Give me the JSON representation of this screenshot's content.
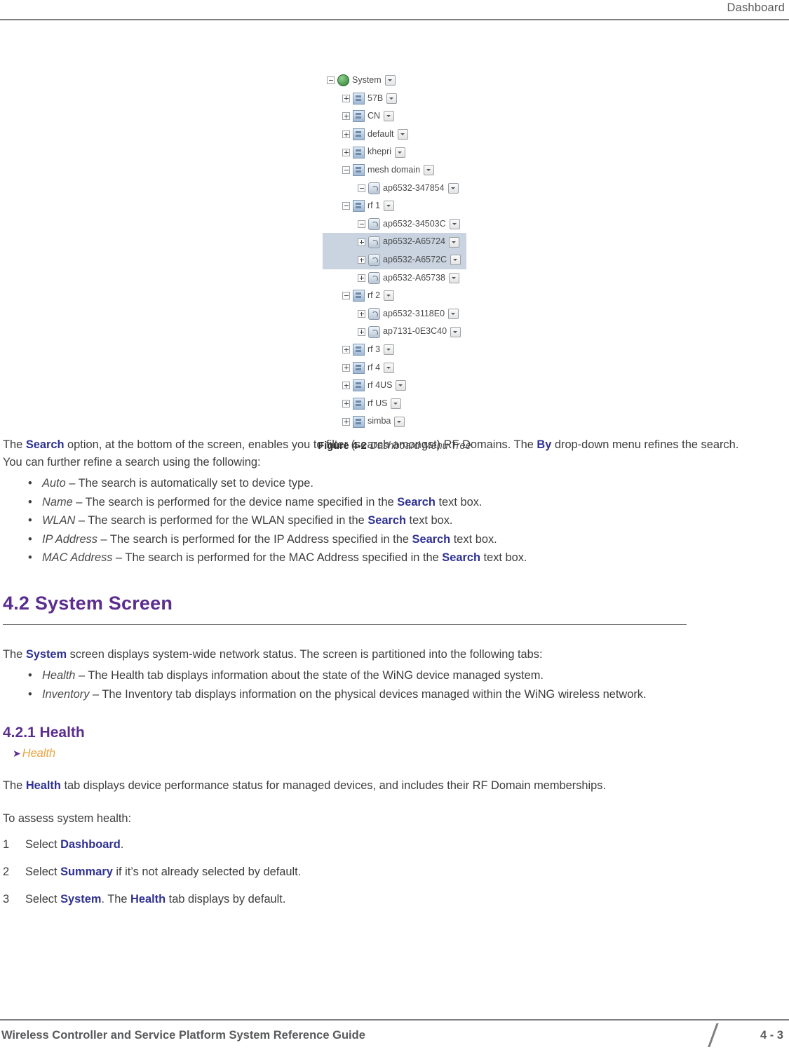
{
  "header": {
    "title": "Dashboard"
  },
  "figure": {
    "caption_number": "Figure 4-2",
    "caption_text": "Dashboard Menu Tree",
    "tree": [
      {
        "level": 0,
        "expander": "minus",
        "icon": "globe-icon",
        "label": "System",
        "arrow": true,
        "selected": false
      },
      {
        "level": 1,
        "expander": "plus",
        "icon": "domain-icon",
        "label": "57B",
        "arrow": true,
        "selected": false
      },
      {
        "level": 1,
        "expander": "plus",
        "icon": "domain-icon",
        "label": "CN",
        "arrow": true,
        "selected": false
      },
      {
        "level": 1,
        "expander": "plus",
        "icon": "domain-icon",
        "label": "default",
        "arrow": true,
        "selected": false
      },
      {
        "level": 1,
        "expander": "plus",
        "icon": "domain-icon",
        "label": "khepri",
        "arrow": true,
        "selected": false
      },
      {
        "level": 1,
        "expander": "minus",
        "icon": "domain-icon",
        "label": "mesh domain",
        "arrow": true,
        "selected": false
      },
      {
        "level": 2,
        "expander": "minus",
        "icon": "ap-icon",
        "label": "ap6532-347854",
        "arrow": true,
        "selected": false
      },
      {
        "level": 1,
        "expander": "minus",
        "icon": "domain-icon",
        "label": "rf 1",
        "arrow": true,
        "selected": false
      },
      {
        "level": 2,
        "expander": "minus",
        "icon": "ap-icon",
        "label": "ap6532-34503C",
        "arrow": true,
        "selected": false
      },
      {
        "level": 2,
        "expander": "plus",
        "icon": "ap-icon",
        "label": "ap6532-A65724",
        "arrow": true,
        "selected": true
      },
      {
        "level": 2,
        "expander": "plus",
        "icon": "ap-icon",
        "label": "ap6532-A6572C",
        "arrow": true,
        "selected": true
      },
      {
        "level": 2,
        "expander": "plus",
        "icon": "ap-icon",
        "label": "ap6532-A65738",
        "arrow": true,
        "selected": false
      },
      {
        "level": 1,
        "expander": "minus",
        "icon": "domain-icon",
        "label": "rf 2",
        "arrow": true,
        "selected": false
      },
      {
        "level": 2,
        "expander": "plus",
        "icon": "ap-icon",
        "label": "ap6532-3118E0",
        "arrow": true,
        "selected": false
      },
      {
        "level": 2,
        "expander": "plus",
        "icon": "ap-icon",
        "label": "ap7131-0E3C40",
        "arrow": true,
        "selected": false
      },
      {
        "level": 1,
        "expander": "plus",
        "icon": "domain-icon",
        "label": "rf 3",
        "arrow": true,
        "selected": false
      },
      {
        "level": 1,
        "expander": "plus",
        "icon": "domain-icon",
        "label": "rf 4",
        "arrow": true,
        "selected": false
      },
      {
        "level": 1,
        "expander": "plus",
        "icon": "domain-icon",
        "label": "rf 4US",
        "arrow": true,
        "selected": false
      },
      {
        "level": 1,
        "expander": "plus",
        "icon": "domain-icon",
        "label": "rf US",
        "arrow": true,
        "selected": false
      },
      {
        "level": 1,
        "expander": "plus",
        "icon": "domain-icon",
        "label": "simba",
        "arrow": true,
        "selected": false
      }
    ]
  },
  "search_paragraph": {
    "p1": "The ",
    "search_label": "Search",
    "p2": " option, at the bottom of the screen, enables you to filter (search amongst) RF Domains. The ",
    "by_label": "By",
    "p3": " drop-down menu refines the search. You can further refine a search using the following:"
  },
  "search_bullets": [
    {
      "term": "Auto",
      "text_before_bold": " – The search is automatically set to device type.",
      "bold": "",
      "text_after_bold": ""
    },
    {
      "term": "Name",
      "text_before_bold": " – The search is performed for the device name specified in the ",
      "bold": "Search",
      "text_after_bold": " text box."
    },
    {
      "term": "WLAN",
      "text_before_bold": " – The search is performed for the WLAN specified in the ",
      "bold": "Search",
      "text_after_bold": " text box."
    },
    {
      "term": "IP Address",
      "text_before_bold": " – The search is performed for the IP Address specified in the ",
      "bold": "Search",
      "text_after_bold": " text box."
    },
    {
      "term": "MAC Address",
      "text_before_bold": " – The search is performed for the MAC Address specified in the ",
      "bold": "Search",
      "text_after_bold": " text box."
    }
  ],
  "section": {
    "heading": "4.2 System Screen",
    "intro_p1": "The ",
    "intro_bold": "System",
    "intro_p2": " screen displays system-wide network status. The screen is partitioned into the following tabs:",
    "bullets": [
      {
        "term": "Health",
        "text": " – The Health tab displays information about the state of the WiNG device managed system."
      },
      {
        "term": "Inventory",
        "text": " – The Inventory tab displays information on the physical devices managed within the WiNG wireless network."
      }
    ]
  },
  "subsection": {
    "heading": "4.2.1 Health",
    "breadcrumb": "Health",
    "para_p1": "The ",
    "para_bold": "Health",
    "para_p2": " tab displays device performance status for managed devices, and includes their RF Domain memberships.",
    "assess_line": "To assess system health:",
    "steps": [
      {
        "num": "1",
        "pre": "Select ",
        "bold": "Dashboard",
        "post": ".",
        "bold2": "",
        "post2": ""
      },
      {
        "num": "2",
        "pre": "Select ",
        "bold": "Summary",
        "post": " if it’s not already selected by default.",
        "bold2": "",
        "post2": ""
      },
      {
        "num": "3",
        "pre": "Select ",
        "bold": "System",
        "post": ". The ",
        "bold2": "Health",
        "post2": " tab displays by default."
      }
    ]
  },
  "footer": {
    "left": "Wireless Controller and Service Platform System Reference Guide",
    "right": "4 - 3"
  }
}
